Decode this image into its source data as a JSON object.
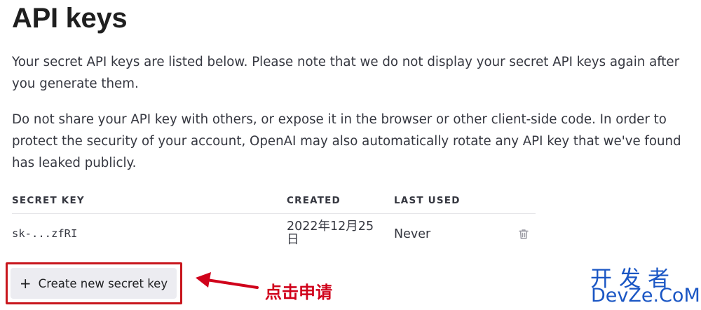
{
  "page": {
    "title": "API keys",
    "paragraph1": "Your secret API keys are listed below. Please note that we do not display your secret API keys again after you generate them.",
    "paragraph2": "Do not share your API key with others, or expose it in the browser or other client-side code. In order to protect the security of your account, OpenAI may also automatically rotate any API key that we've found has leaked publicly."
  },
  "table": {
    "columns": [
      "SECRET KEY",
      "CREATED",
      "LAST USED"
    ],
    "rows": [
      {
        "key": "sk-...zfRI",
        "created": "2022年12月25日",
        "last_used": "Never",
        "action_icon": "trash-icon"
      }
    ]
  },
  "create_button": {
    "icon": "plus",
    "label": "Create new secret key"
  },
  "annotation": {
    "text": "点击申请",
    "color": "#d0021b"
  },
  "watermark": {
    "chinese": "开发者",
    "english": "DevZe.CoM",
    "color": "#1a56c4"
  },
  "colors": {
    "text": "#353740",
    "button_bg": "#ececf1",
    "highlight_border": "#c8161d"
  }
}
